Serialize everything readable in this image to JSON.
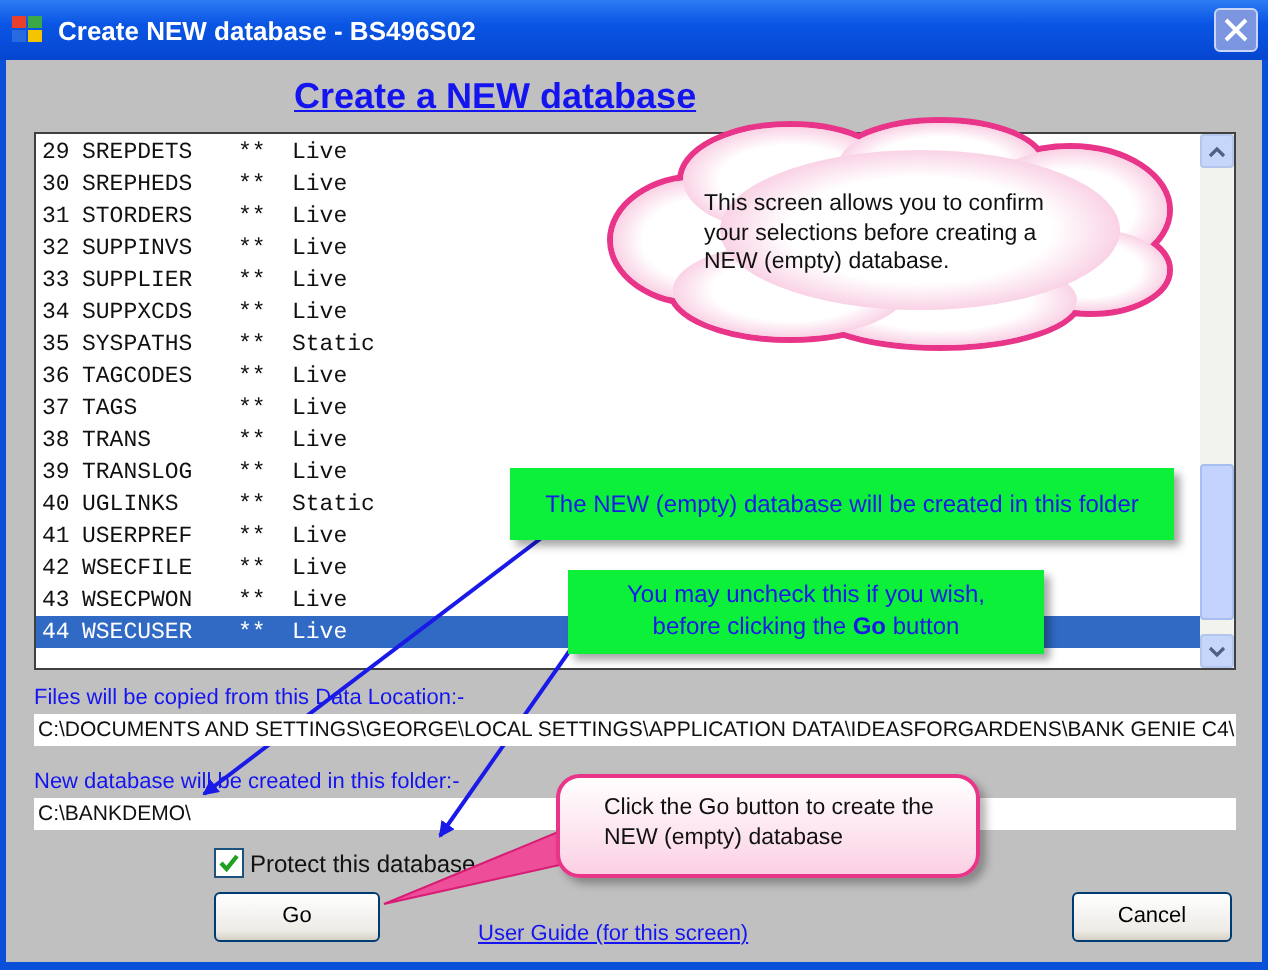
{
  "window": {
    "title": "Create NEW database - BS496S02"
  },
  "heading": "Create a NEW database",
  "list": {
    "rows": [
      {
        "number": "29",
        "name": "SREPDETS",
        "mark": "**",
        "status": "Live",
        "selected": false
      },
      {
        "number": "30",
        "name": "SREPHEDS",
        "mark": "**",
        "status": "Live",
        "selected": false
      },
      {
        "number": "31",
        "name": "STORDERS",
        "mark": "**",
        "status": "Live",
        "selected": false
      },
      {
        "number": "32",
        "name": "SUPPINVS",
        "mark": "**",
        "status": "Live",
        "selected": false
      },
      {
        "number": "33",
        "name": "SUPPLIER",
        "mark": "**",
        "status": "Live",
        "selected": false
      },
      {
        "number": "34",
        "name": "SUPPXCDS",
        "mark": "**",
        "status": "Live",
        "selected": false
      },
      {
        "number": "35",
        "name": "SYSPATHS",
        "mark": "**",
        "status": "Static",
        "selected": false
      },
      {
        "number": "36",
        "name": "TAGCODES",
        "mark": "**",
        "status": "Live",
        "selected": false
      },
      {
        "number": "37",
        "name": "TAGS",
        "mark": "**",
        "status": "Live",
        "selected": false
      },
      {
        "number": "38",
        "name": "TRANS",
        "mark": "**",
        "status": "Live",
        "selected": false
      },
      {
        "number": "39",
        "name": "TRANSLOG",
        "mark": "**",
        "status": "Live",
        "selected": false
      },
      {
        "number": "40",
        "name": "UGLINKS",
        "mark": "**",
        "status": "Static",
        "selected": false
      },
      {
        "number": "41",
        "name": "USERPREF",
        "mark": "**",
        "status": "Live",
        "selected": false
      },
      {
        "number": "42",
        "name": "WSECFILE",
        "mark": "**",
        "status": "Live",
        "selected": false
      },
      {
        "number": "43",
        "name": "WSECPWON",
        "mark": "**",
        "status": "Live",
        "selected": false
      },
      {
        "number": "44",
        "name": "WSECUSER",
        "mark": "**",
        "status": "Live",
        "selected": true
      }
    ]
  },
  "source": {
    "label": "Files will be copied from this Data Location:-",
    "value": "C:\\DOCUMENTS AND SETTINGS\\GEORGE\\LOCAL SETTINGS\\APPLICATION DATA\\IDEASFORGARDENS\\BANK GENIE C4\\"
  },
  "target": {
    "label": "New database will be created in this folder:-",
    "value": "C:\\BANKDEMO\\"
  },
  "protect": {
    "label": "Protect this database",
    "checked": true
  },
  "buttons": {
    "go": "Go",
    "cancel": "Cancel"
  },
  "link": "User Guide (for this screen)",
  "callouts": [
    {
      "kind": "cloud",
      "text": "This screen allows you to confirm your selections before creating a NEW (empty) database."
    },
    {
      "kind": "green-folder",
      "text": "The NEW (empty) database will be created in this folder"
    },
    {
      "kind": "green-check",
      "text": "You may uncheck this if you wish, before clicking the **Go** button"
    },
    {
      "kind": "pink",
      "text": "Click the Go button to create the NEW (empty) database"
    }
  ]
}
